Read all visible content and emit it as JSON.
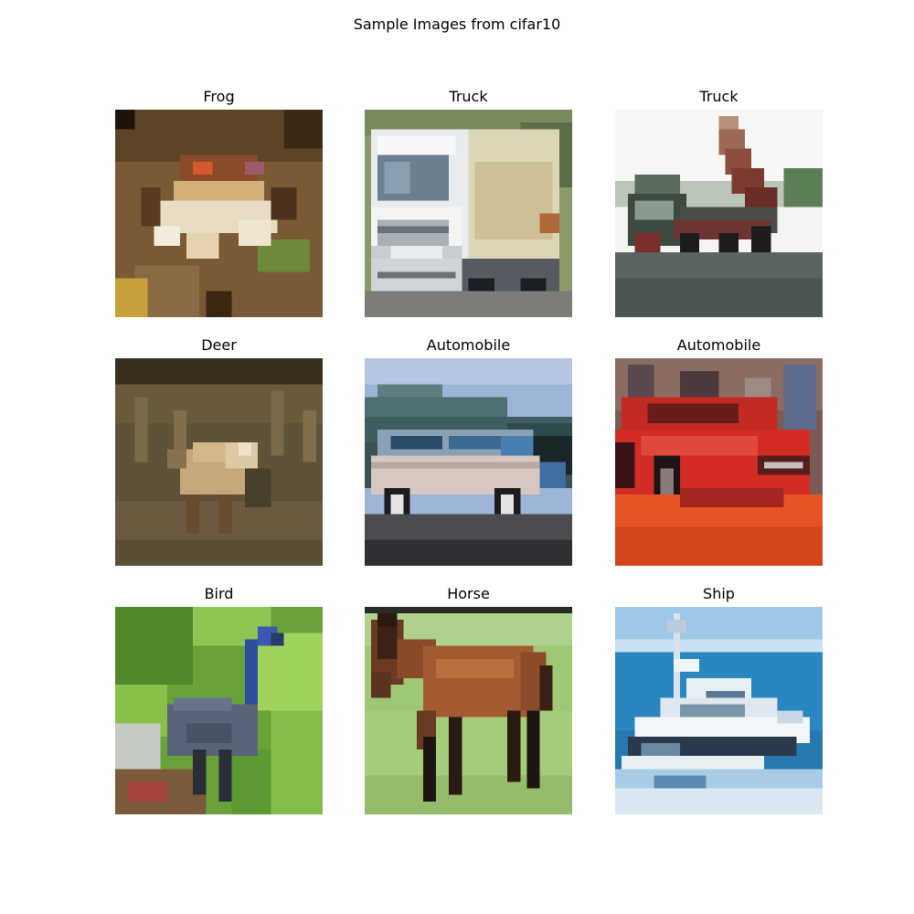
{
  "figure": {
    "title": "Sample Images from cifar10"
  },
  "samples": [
    {
      "label": "Frog",
      "icon": "frog-image"
    },
    {
      "label": "Truck",
      "icon": "truck-image"
    },
    {
      "label": "Truck",
      "icon": "dump-truck-image"
    },
    {
      "label": "Deer",
      "icon": "deer-image"
    },
    {
      "label": "Automobile",
      "icon": "silver-car-image"
    },
    {
      "label": "Automobile",
      "icon": "red-car-image"
    },
    {
      "label": "Bird",
      "icon": "ostrich-image"
    },
    {
      "label": "Horse",
      "icon": "horse-image"
    },
    {
      "label": "Ship",
      "icon": "boat-image"
    }
  ]
}
